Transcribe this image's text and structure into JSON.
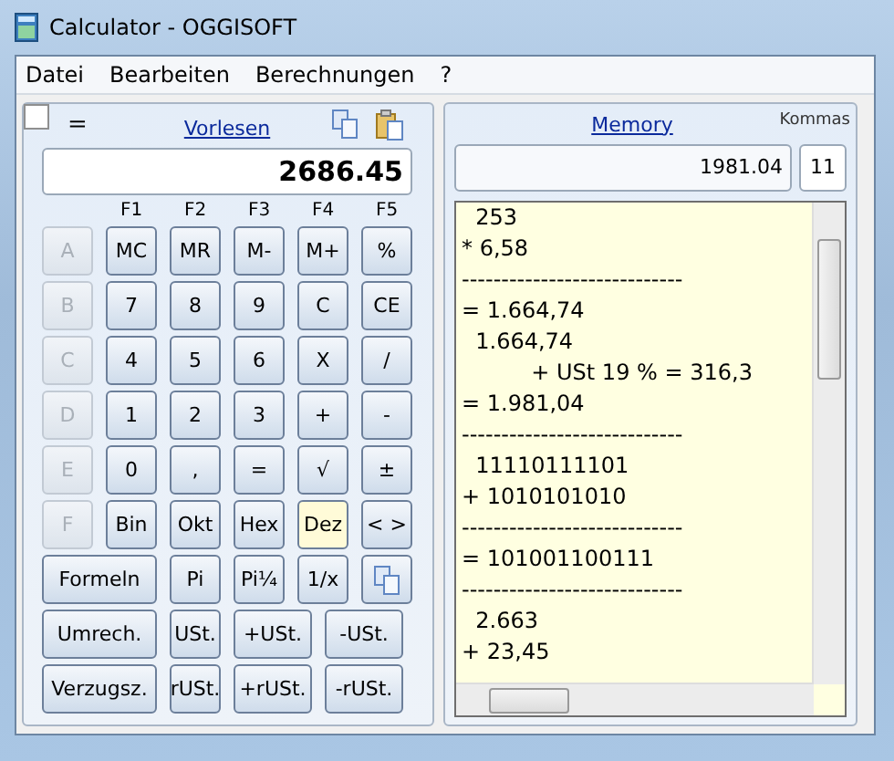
{
  "window": {
    "title": "Calculator - OGGISOFT"
  },
  "menu": [
    "Datei",
    "Bearbeiten",
    "Berechnungen",
    "?"
  ],
  "calculator": {
    "result_checkbox": {
      "checked": false
    },
    "equals_label": "=",
    "read_aloud_link": "Vorlesen",
    "display": "2686.45",
    "function_labels": [
      "F1",
      "F2",
      "F3",
      "F4",
      "F5"
    ],
    "key_rows": [
      [
        {
          "label": "A",
          "kind": "text",
          "disabled": true,
          "selected": false
        },
        {
          "label": "MC",
          "kind": "text",
          "disabled": false,
          "selected": false
        },
        {
          "label": "MR",
          "kind": "text",
          "disabled": false,
          "selected": false
        },
        {
          "label": "M-",
          "kind": "text",
          "disabled": false,
          "selected": false
        },
        {
          "label": "M+",
          "kind": "text",
          "disabled": false,
          "selected": false
        },
        {
          "label": "%",
          "kind": "text",
          "disabled": false,
          "selected": false
        }
      ],
      [
        {
          "label": "B",
          "kind": "text",
          "disabled": true,
          "selected": false
        },
        {
          "label": "7",
          "kind": "text",
          "disabled": false,
          "selected": false
        },
        {
          "label": "8",
          "kind": "text",
          "disabled": false,
          "selected": false
        },
        {
          "label": "9",
          "kind": "text",
          "disabled": false,
          "selected": false
        },
        {
          "label": "C",
          "kind": "text",
          "disabled": false,
          "selected": false
        },
        {
          "label": "CE",
          "kind": "text",
          "disabled": false,
          "selected": false
        }
      ],
      [
        {
          "label": "C",
          "kind": "text",
          "disabled": true,
          "selected": false
        },
        {
          "label": "4",
          "kind": "text",
          "disabled": false,
          "selected": false
        },
        {
          "label": "5",
          "kind": "text",
          "disabled": false,
          "selected": false
        },
        {
          "label": "6",
          "kind": "text",
          "disabled": false,
          "selected": false
        },
        {
          "label": "X",
          "kind": "text",
          "disabled": false,
          "selected": false
        },
        {
          "label": "/",
          "kind": "text",
          "disabled": false,
          "selected": false
        }
      ],
      [
        {
          "label": "D",
          "kind": "text",
          "disabled": true,
          "selected": false
        },
        {
          "label": "1",
          "kind": "text",
          "disabled": false,
          "selected": false
        },
        {
          "label": "2",
          "kind": "text",
          "disabled": false,
          "selected": false
        },
        {
          "label": "3",
          "kind": "text",
          "disabled": false,
          "selected": false
        },
        {
          "label": "+",
          "kind": "text",
          "disabled": false,
          "selected": false
        },
        {
          "label": "-",
          "kind": "text",
          "disabled": false,
          "selected": false
        }
      ],
      [
        {
          "label": "E",
          "kind": "text",
          "disabled": true,
          "selected": false
        },
        {
          "label": "0",
          "kind": "text",
          "disabled": false,
          "selected": false
        },
        {
          "label": ",",
          "kind": "text",
          "disabled": false,
          "selected": false
        },
        {
          "label": "=",
          "kind": "text",
          "disabled": false,
          "selected": false
        },
        {
          "label": "√",
          "kind": "text",
          "disabled": false,
          "selected": false
        },
        {
          "label": "±",
          "kind": "text",
          "disabled": false,
          "selected": false
        }
      ],
      [
        {
          "label": "F",
          "kind": "text",
          "disabled": true,
          "selected": false
        },
        {
          "label": "Bin",
          "kind": "text",
          "disabled": false,
          "selected": false
        },
        {
          "label": "Okt",
          "kind": "text",
          "disabled": false,
          "selected": false
        },
        {
          "label": "Hex",
          "kind": "text",
          "disabled": false,
          "selected": false
        },
        {
          "label": "Dez",
          "kind": "text",
          "disabled": false,
          "selected": true
        },
        {
          "label": "< >",
          "kind": "text",
          "disabled": false,
          "selected": false
        }
      ],
      [
        {
          "label": "Formeln",
          "kind": "wide",
          "disabled": false,
          "selected": false
        },
        {
          "label": "Pi",
          "kind": "text",
          "disabled": false,
          "selected": false
        },
        {
          "label": "Pi¼",
          "kind": "text",
          "disabled": false,
          "selected": false
        },
        {
          "label": "1/x",
          "kind": "text",
          "disabled": false,
          "selected": false
        },
        {
          "kind": "copy",
          "disabled": false,
          "selected": false
        }
      ],
      [
        {
          "label": "Umrech.",
          "kind": "wide",
          "disabled": false,
          "selected": false
        },
        {
          "label": "USt.",
          "kind": "text",
          "disabled": false,
          "selected": false
        },
        {
          "label": "+USt.",
          "kind": "medium",
          "disabled": false,
          "selected": false
        },
        {
          "label": "-USt.",
          "kind": "medium",
          "disabled": false,
          "selected": false
        }
      ],
      [
        {
          "label": "Verzugsz.",
          "kind": "wide",
          "disabled": false,
          "selected": false
        },
        {
          "label": "rUSt.",
          "kind": "text",
          "disabled": false,
          "selected": false
        },
        {
          "label": "+rUSt.",
          "kind": "medium",
          "disabled": false,
          "selected": false
        },
        {
          "label": "-rUSt.",
          "kind": "medium",
          "disabled": false,
          "selected": false
        }
      ]
    ]
  },
  "memory": {
    "link": "Memory",
    "decimals_label": "Kommas",
    "value": "1981.04",
    "decimals": "11",
    "tape": [
      "  253",
      "* 6,58",
      "----------------------------",
      "= 1.664,74",
      "  1.664,74",
      "          + USt 19 % = 316,3",
      "= 1.981,04",
      "----------------------------",
      "  11110111101",
      "+ 1010101010",
      "----------------------------",
      "= 101001100111",
      "----------------------------",
      "  2.663",
      "+ 23,45"
    ]
  }
}
